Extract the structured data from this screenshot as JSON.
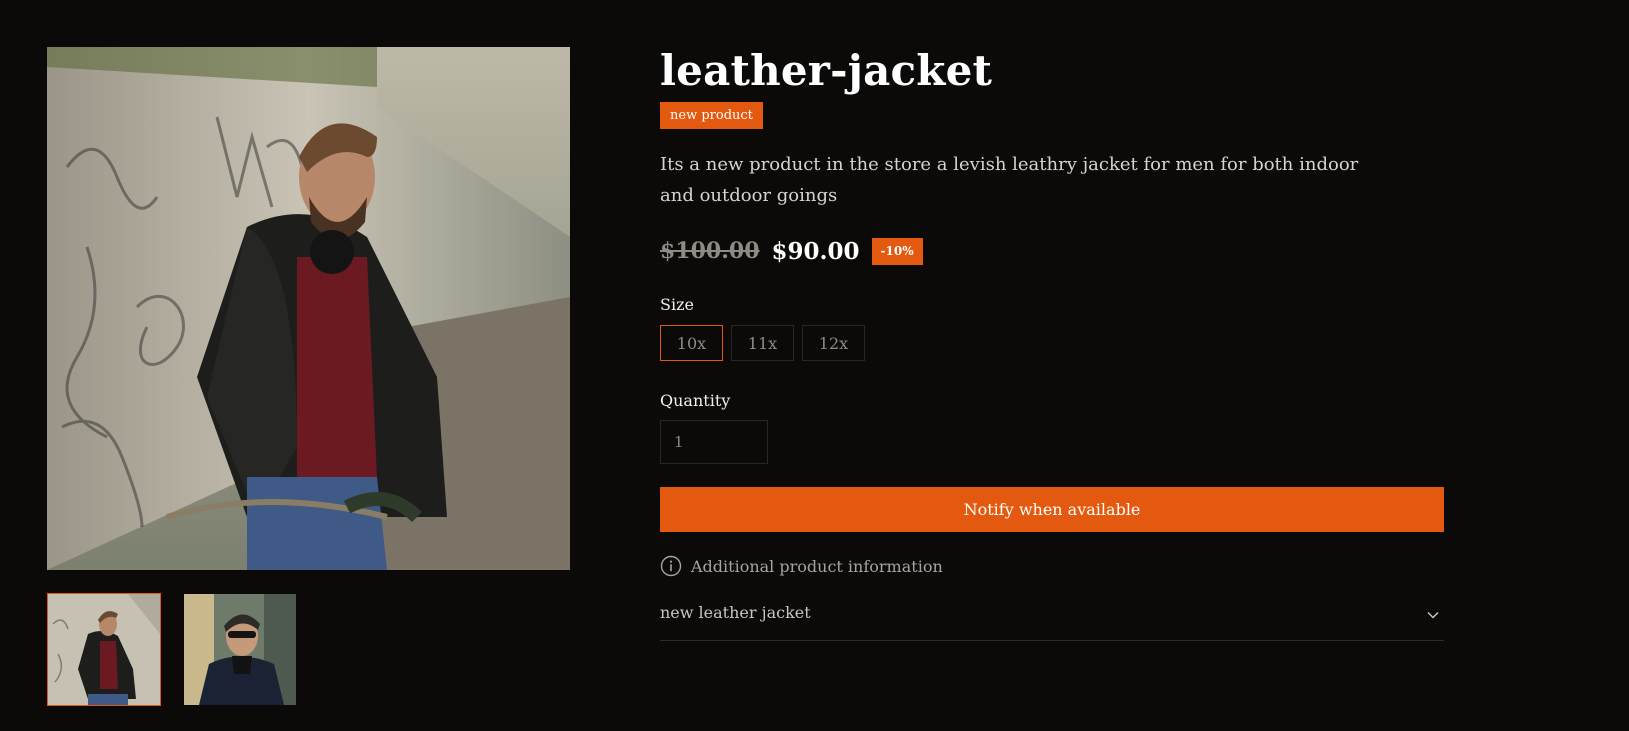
{
  "product": {
    "title": "leather-jacket",
    "badge": "new product",
    "description": "Its a new product in the store a levish leathry jacket for men for both indoor and outdoor goings",
    "price": {
      "original": "$100.00",
      "current": "$90.00",
      "discount": "-10%"
    },
    "size": {
      "label": "Size",
      "options": [
        "10x",
        "11x",
        "12x"
      ],
      "selected": "10x"
    },
    "quantity": {
      "label": "Quantity",
      "value": "1"
    },
    "notify_label": "Notify when available",
    "additional_info_label": "Additional product information",
    "accordion": {
      "title": "new leather jacket"
    }
  },
  "gallery": {
    "main_image": "man-in-leather-jacket-photo",
    "thumbnails": [
      "thumbnail-man-graffiti-wall",
      "thumbnail-man-sunglasses"
    ],
    "selected_thumbnail": 0
  },
  "colors": {
    "accent": "#e2590f",
    "background": "#0b0a08",
    "text": "#f3f0ea",
    "muted": "#8f8a83"
  }
}
